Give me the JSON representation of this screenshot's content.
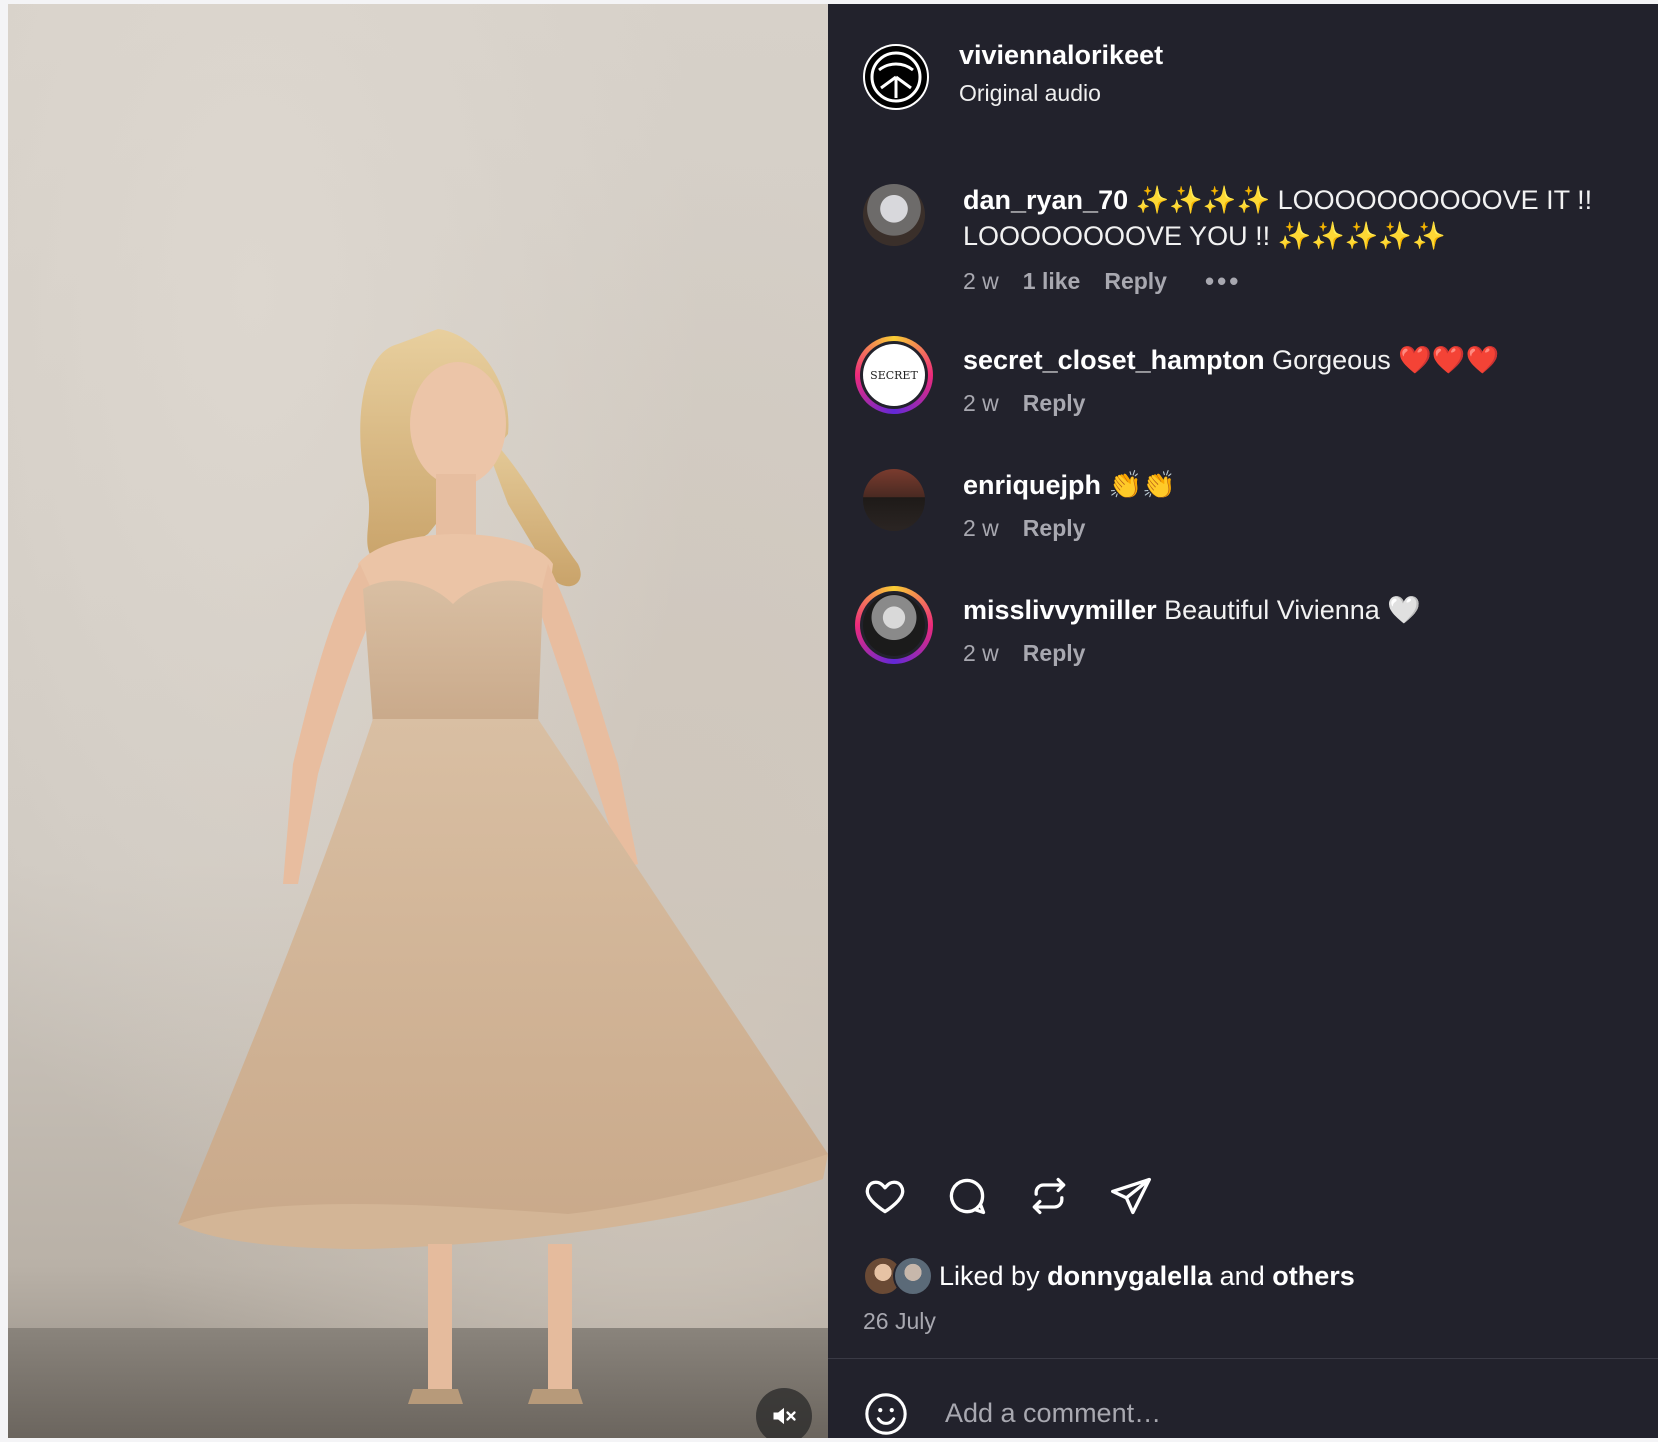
{
  "post": {
    "author": "viviennalorikeet",
    "audio": "Original audio"
  },
  "comments": [
    {
      "user": "dan_ryan_70",
      "text": "✨✨✨✨ LOOOOOOOOOOVE IT !! LOOOOOOOOVE YOU !! ✨✨✨✨✨",
      "time": "2 w",
      "likes": "1 like",
      "reply": "Reply",
      "more": "•••"
    },
    {
      "user": "secret_closet_hampton",
      "text": "Gorgeous ❤️❤️❤️",
      "time": "2 w",
      "reply": "Reply",
      "avatar_text": "SECRET"
    },
    {
      "user": "enriquejph",
      "text": "👏👏",
      "time": "2 w",
      "reply": "Reply"
    },
    {
      "user": "misslivvymiller",
      "text": "Beautiful Vivienna 🤍",
      "time": "2 w",
      "reply": "Reply"
    }
  ],
  "actions": {
    "icons": [
      "heart-icon",
      "comment-icon",
      "repost-icon",
      "share-icon"
    ]
  },
  "likes": {
    "prefix": "Liked by",
    "user": "donnygalella",
    "middle": "and",
    "others": "others"
  },
  "date": "26 July",
  "comment_input": {
    "placeholder": "Add a comment…"
  },
  "colors": {
    "panel_bg": "#22222c",
    "muted_text": "#a8a8b0",
    "story_ring": [
      "#f9ce34",
      "#ee2a7b",
      "#6228d7"
    ]
  }
}
